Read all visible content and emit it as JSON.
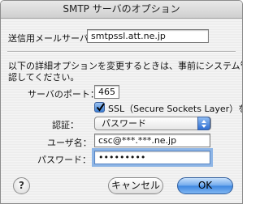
{
  "window": {
    "title": "SMTP サーバのオプション"
  },
  "server": {
    "label": "送信用メールサーバ：",
    "value": "smtpssl.att.ne.jp"
  },
  "notice": {
    "line1": "以下の詳細オプションを変更するときは、事前にシステム管理者に確",
    "line2": "認してください。"
  },
  "port": {
    "label": "サーバのポート：",
    "value": "465"
  },
  "ssl": {
    "label": "SSL（Secure Sockets Layer）を使用",
    "checked": true
  },
  "auth": {
    "label": "認証：",
    "selected": "パスワード"
  },
  "username": {
    "label": "ユーザ名：",
    "value": "csc@***.***.ne.jp"
  },
  "password": {
    "label": "パスワード：",
    "value": "•••••••••"
  },
  "buttons": {
    "help": "?",
    "cancel": "キャンセル",
    "ok": "OK"
  },
  "colors": {
    "accent": "#3f87e0",
    "focus_ring": "#8db5e6"
  }
}
